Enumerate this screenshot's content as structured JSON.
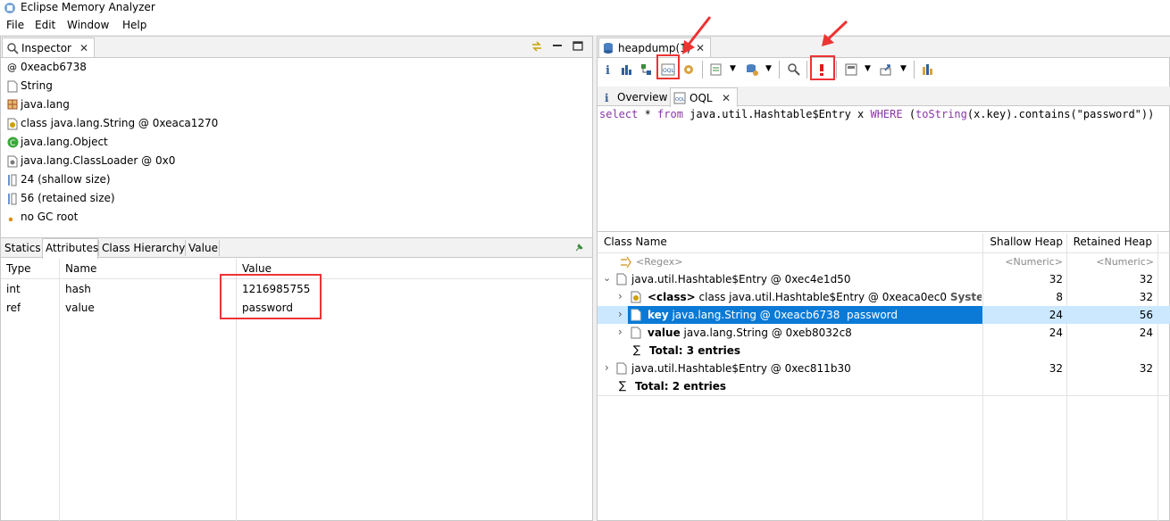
{
  "app": {
    "title": "Eclipse Memory Analyzer"
  },
  "menu": [
    "File",
    "Edit",
    "Window",
    "Help"
  ],
  "inspector": {
    "tab_label": "Inspector",
    "rows": [
      "0xeacb6738",
      "String",
      "java.lang",
      "class java.lang.String @ 0xeaca1270",
      "java.lang.Object",
      "java.lang.ClassLoader @ 0x0",
      "24 (shallow size)",
      "56 (retained size)",
      "no GC root"
    ],
    "bottom_tabs": [
      "Statics",
      "Attributes",
      "Class Hierarchy",
      "Value"
    ],
    "columns": [
      "Type",
      "Name",
      "Value"
    ],
    "attributes": [
      {
        "type": "int",
        "name": "hash",
        "value": "1216985755"
      },
      {
        "type": "ref",
        "name": "value",
        "value": "password"
      }
    ]
  },
  "editor": {
    "tab_label": "heapdump(1)",
    "subtabs": [
      "Overview",
      "OQL"
    ],
    "query": {
      "kw1": "select",
      "t1": " * ",
      "kw2": "from",
      "t2": " java.util.Hashtable$Entry x ",
      "kw3": "WHERE",
      "t3": " (",
      "kw4": "toString",
      "t4": "(x.key).contains(\"password\"))"
    },
    "columns": [
      "Class Name",
      "Shallow Heap",
      "Retained Heap"
    ],
    "filters": [
      "<Regex>",
      "<Numeric>",
      "<Numeric>"
    ],
    "rows": [
      {
        "label": "java.util.Hashtable$Entry @ 0xec4e1d50",
        "bold": "",
        "rest": "",
        "shallow": "32",
        "retained": "32"
      },
      {
        "label": "",
        "bold": "<class>",
        "rest": " class java.util.Hashtable$Entry @ 0xeaca0ec0 ",
        "extra": "System Cl",
        "shallow": "8",
        "retained": "32"
      },
      {
        "label": "",
        "bold": "key",
        "rest": " java.lang.String @ 0xeacb6738  password",
        "shallow": "24",
        "retained": "56"
      },
      {
        "label": "",
        "bold": "value",
        "rest": " java.lang.String @ 0xeb8032c8",
        "shallow": "24",
        "retained": "24"
      },
      {
        "label": "",
        "bold": "Total: 3 entries",
        "rest": "",
        "shallow": "",
        "retained": ""
      },
      {
        "label": "java.util.Hashtable$Entry @ 0xec811b30",
        "bold": "",
        "rest": "",
        "shallow": "32",
        "retained": "32"
      },
      {
        "label": "",
        "bold": "Total: 2 entries",
        "rest": "",
        "shallow": "",
        "retained": ""
      }
    ]
  },
  "colors": {
    "selection": "#0a7ad6",
    "highlight_box": "#e33333",
    "keyword": "#8b36a8"
  }
}
